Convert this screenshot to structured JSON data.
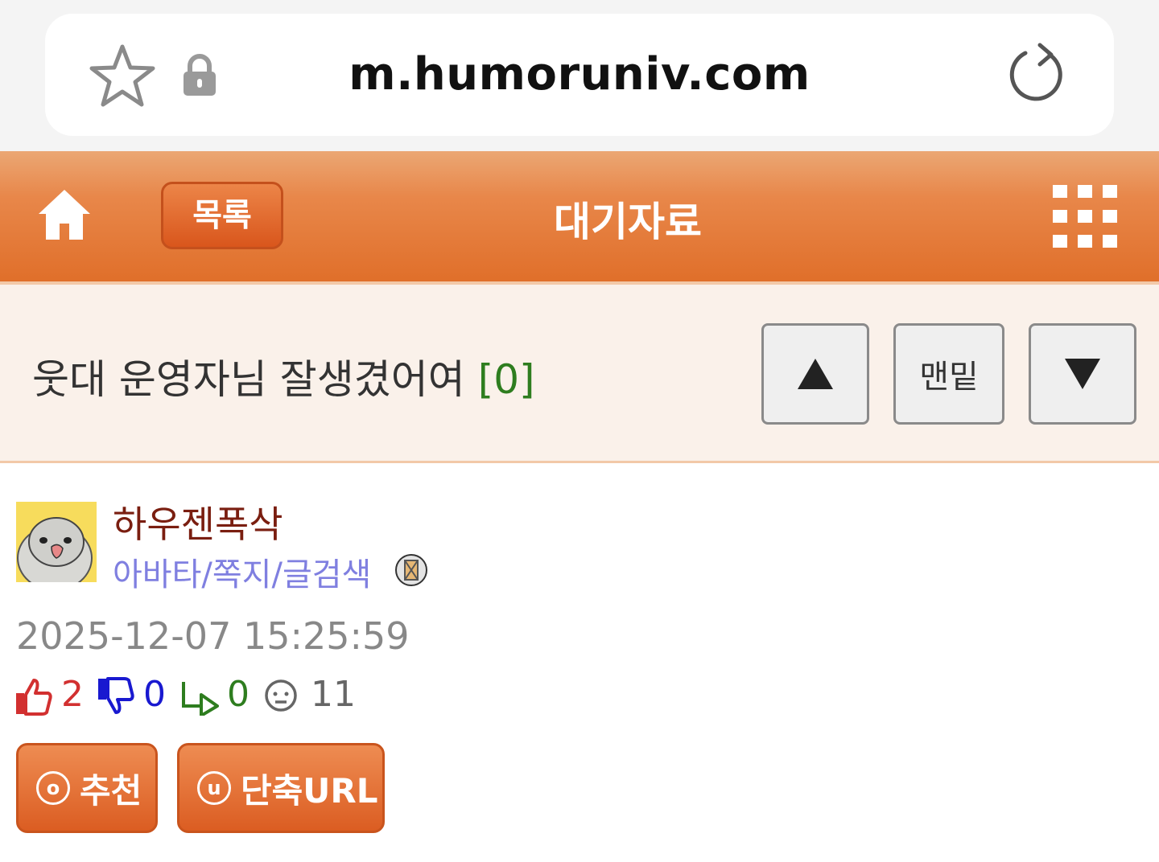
{
  "browser": {
    "url": "m.humoruniv.com",
    "icons": [
      "star-icon",
      "lock-icon",
      "reload-icon"
    ]
  },
  "header": {
    "list_label": "목록",
    "title": "대기자료",
    "icons": [
      "home-icon",
      "grid-menu-icon"
    ],
    "accent_color": "#e06f2a"
  },
  "post": {
    "title": "웃대 운영자님 잘생겼어여",
    "comment_count": "[0]",
    "nav": {
      "up_symbol": "▲",
      "bottom_label": "맨밑",
      "down_symbol": "▼"
    },
    "author": {
      "name": "하우젠폭삭",
      "links": "아바타/쪽지/글검색"
    },
    "datetime": "2025-12-07 15:25:59",
    "stats": {
      "up": "2",
      "down": "0",
      "replies": "0",
      "views": "11"
    },
    "actions": {
      "recommend_icon_letter": "o",
      "recommend_label": "추천",
      "shorturl_icon_letter": "u",
      "shorturl_label": "단축URL"
    }
  }
}
